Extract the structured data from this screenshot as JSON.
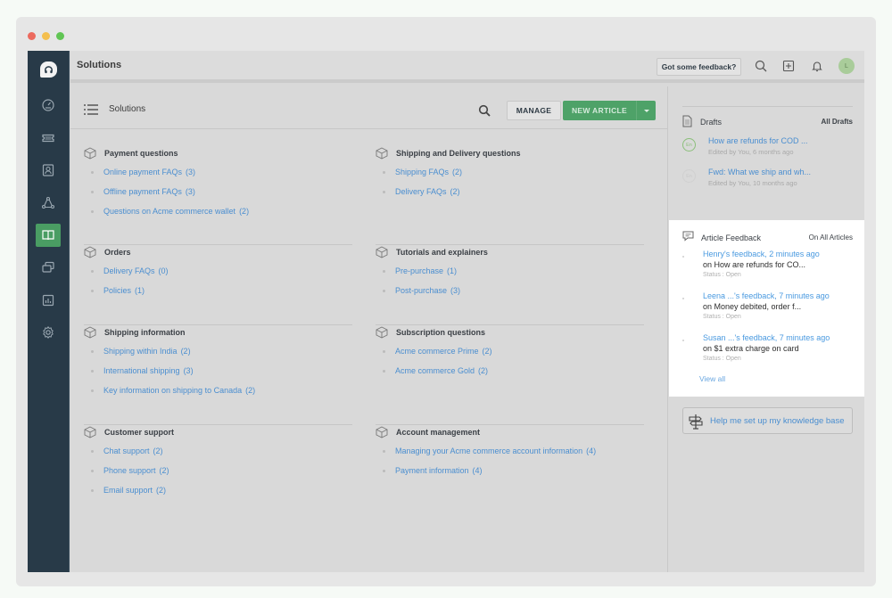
{
  "window": {
    "traffic_lights": [
      "close",
      "minimize",
      "zoom"
    ]
  },
  "sidebar": {
    "logo_icon": "headset-icon",
    "items": [
      {
        "name": "dashboard",
        "icon": "gauge-icon",
        "active": false
      },
      {
        "name": "tickets",
        "icon": "ticket-icon",
        "active": false
      },
      {
        "name": "contacts",
        "icon": "contact-card-icon",
        "active": false
      },
      {
        "name": "social",
        "icon": "network-icon",
        "active": false
      },
      {
        "name": "solutions",
        "icon": "book-icon",
        "active": true
      },
      {
        "name": "forums",
        "icon": "chat-windows-icon",
        "active": false
      },
      {
        "name": "reports",
        "icon": "bar-chart-icon",
        "active": false
      },
      {
        "name": "admin",
        "icon": "gear-icon",
        "active": false
      }
    ],
    "accent_color": "#4a9d63"
  },
  "topbar": {
    "title": "Solutions",
    "feedback_button": "Got some feedback?",
    "icons": [
      "search-icon",
      "plus-box-icon",
      "bell-icon"
    ],
    "avatar_initial": "L"
  },
  "main": {
    "header_title": "Solutions",
    "manage_button": "MANAGE",
    "new_article_button": "NEW ARTICLE",
    "categories": [
      {
        "title": "Payment questions",
        "folders": [
          {
            "name": "Online payment FAQs",
            "count": "(3)"
          },
          {
            "name": "Offline payment FAQs",
            "count": "(3)"
          },
          {
            "name": "Questions on Acme commerce wallet",
            "count": "(2)"
          }
        ]
      },
      {
        "title": "Shipping and Delivery questions",
        "folders": [
          {
            "name": "Shipping FAQs",
            "count": "(2)"
          },
          {
            "name": "Delivery FAQs",
            "count": "(2)"
          }
        ]
      },
      {
        "title": "Orders",
        "folders": [
          {
            "name": "Delivery FAQs",
            "count": "(0)"
          },
          {
            "name": "Policies",
            "count": "(1)"
          }
        ]
      },
      {
        "title": "Tutorials and explainers",
        "folders": [
          {
            "name": "Pre-purchase",
            "count": "(1)"
          },
          {
            "name": "Post-purchase",
            "count": "(3)"
          }
        ]
      },
      {
        "title": "Shipping information",
        "folders": [
          {
            "name": "Shipping within India",
            "count": "(2)"
          },
          {
            "name": "International shipping",
            "count": "(3)"
          },
          {
            "name": "Key information on shipping to Canada",
            "count": "(2)"
          }
        ]
      },
      {
        "title": "Subscription questions",
        "folders": [
          {
            "name": "Acme commerce Prime",
            "count": "(2)"
          },
          {
            "name": "Acme commerce Gold",
            "count": "(2)"
          }
        ]
      },
      {
        "title": "Customer support",
        "folders": [
          {
            "name": "Chat support",
            "count": "(2)"
          },
          {
            "name": "Phone support",
            "count": "(2)"
          },
          {
            "name": "Email support",
            "count": "(2)"
          }
        ]
      },
      {
        "title": "Account management",
        "folders": [
          {
            "name": "Managing your Acme commerce account information",
            "count": "(4)"
          },
          {
            "name": "Payment information",
            "count": "(4)"
          }
        ]
      }
    ]
  },
  "right_panel": {
    "drafts": {
      "title": "Drafts",
      "all_link": "All Drafts",
      "items": [
        {
          "lang": "En",
          "title": "How are refunds for COD ...",
          "meta": "Edited by You, 6 months ago"
        },
        {
          "lang": "En",
          "title": "Fwd: What we ship and wh...",
          "meta": "Edited by You, 10 months ago"
        }
      ]
    },
    "feedback": {
      "title": "Article Feedback",
      "filter": "On All Articles",
      "items": [
        {
          "who": "Henry's feedback, 2 minutes ago",
          "on": "on How are refunds for CO...",
          "status": "Status : Open"
        },
        {
          "who": "Leena ...'s feedback, 7 minutes ago",
          "on": "on Money debited, order f...",
          "status": "Status : Open"
        },
        {
          "who": "Susan ...'s feedback, 7 minutes ago",
          "on": "on $1 extra charge on card",
          "status": "Status : Open"
        }
      ],
      "view_all": "View all"
    },
    "help_button": "Help me set up my knowledge base"
  }
}
